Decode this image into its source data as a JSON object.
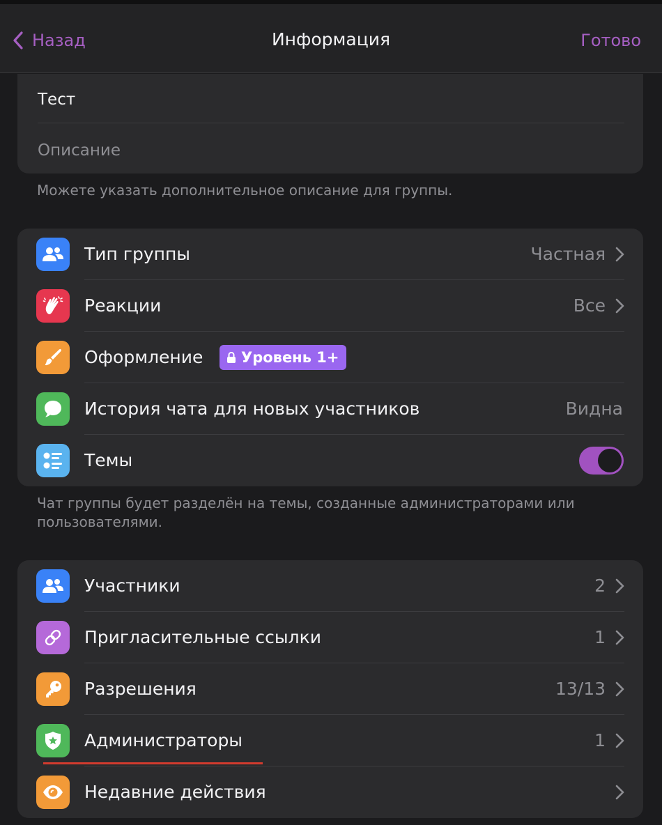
{
  "nav": {
    "back_label": "Назад",
    "title": "Информация",
    "done_label": "Готово"
  },
  "info": {
    "title_value": "Тест",
    "description_placeholder": "Описание",
    "footnote": "Можете указать дополнительное описание для группы."
  },
  "settings": {
    "group_type": {
      "label": "Тип группы",
      "value": "Частная",
      "icon": "people-icon",
      "color": "#3a82f7"
    },
    "reactions": {
      "label": "Реакции",
      "value": "Все",
      "icon": "clapping-hands-icon",
      "color": "#e6374f"
    },
    "appearance": {
      "label": "Оформление",
      "badge": "Уровень 1+",
      "icon": "brush-icon",
      "color": "#f29a38",
      "badge_color": "#9a67f0"
    },
    "history": {
      "label": "История чата для новых участников",
      "value": "Видна",
      "icon": "chat-bubble-icon",
      "color": "#4fb85a"
    },
    "topics": {
      "label": "Темы",
      "enabled": true,
      "icon": "list-icon",
      "color": "#5ab3ef"
    },
    "footnote": "Чат группы будет разделён на темы, созданные администраторами или пользователями."
  },
  "management": {
    "members": {
      "label": "Участники",
      "value": "2",
      "icon": "people-icon",
      "color": "#3a82f7"
    },
    "invite_links": {
      "label": "Пригласительные ссылки",
      "value": "1",
      "icon": "link-icon",
      "color": "#b569d9"
    },
    "permissions": {
      "label": "Разрешения",
      "value": "13/13",
      "icon": "key-icon",
      "color": "#f29a38"
    },
    "admins": {
      "label": "Администраторы",
      "value": "1",
      "icon": "shield-star-icon",
      "color": "#4fb85a"
    },
    "recent_actions": {
      "label": "Недавние действия",
      "icon": "eye-icon",
      "color": "#f29a38"
    }
  },
  "accent": "#a65fc3"
}
